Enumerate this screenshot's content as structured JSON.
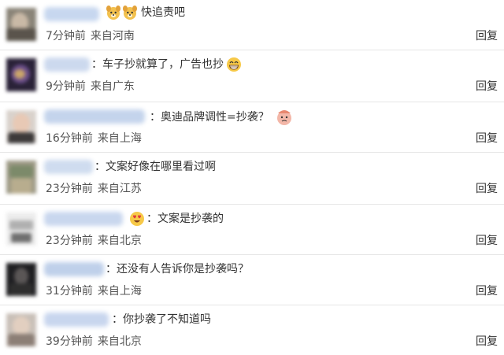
{
  "reply_label": "回复",
  "comments": [
    {
      "text": "快追责吧",
      "time": "7分钟前",
      "location": "来自河南"
    },
    {
      "text": "：车子抄就算了，广告也抄",
      "time": "9分钟前",
      "location": "来自广东"
    },
    {
      "text": "：奥迪品牌调性=抄袭？",
      "time": "16分钟前",
      "location": "来自上海"
    },
    {
      "text": "：文案好像在哪里看过啊",
      "time": "23分钟前",
      "location": "来自江苏"
    },
    {
      "text": "：文案是抄袭的",
      "time": "23分钟前",
      "location": "来自北京"
    },
    {
      "text": "：还没有人告诉你是抄袭吗？",
      "time": "31分钟前",
      "location": "来自上海"
    },
    {
      "text": "：你抄袭了不知道吗",
      "time": "39分钟前",
      "location": "来自北京"
    }
  ],
  "icons": {
    "c1": "dog-face-emoji-icon",
    "c2": "grinning-emoji-icon",
    "c3": "confused-face-emoji-icon",
    "c5": "heart-eyes-emoji-icon"
  }
}
